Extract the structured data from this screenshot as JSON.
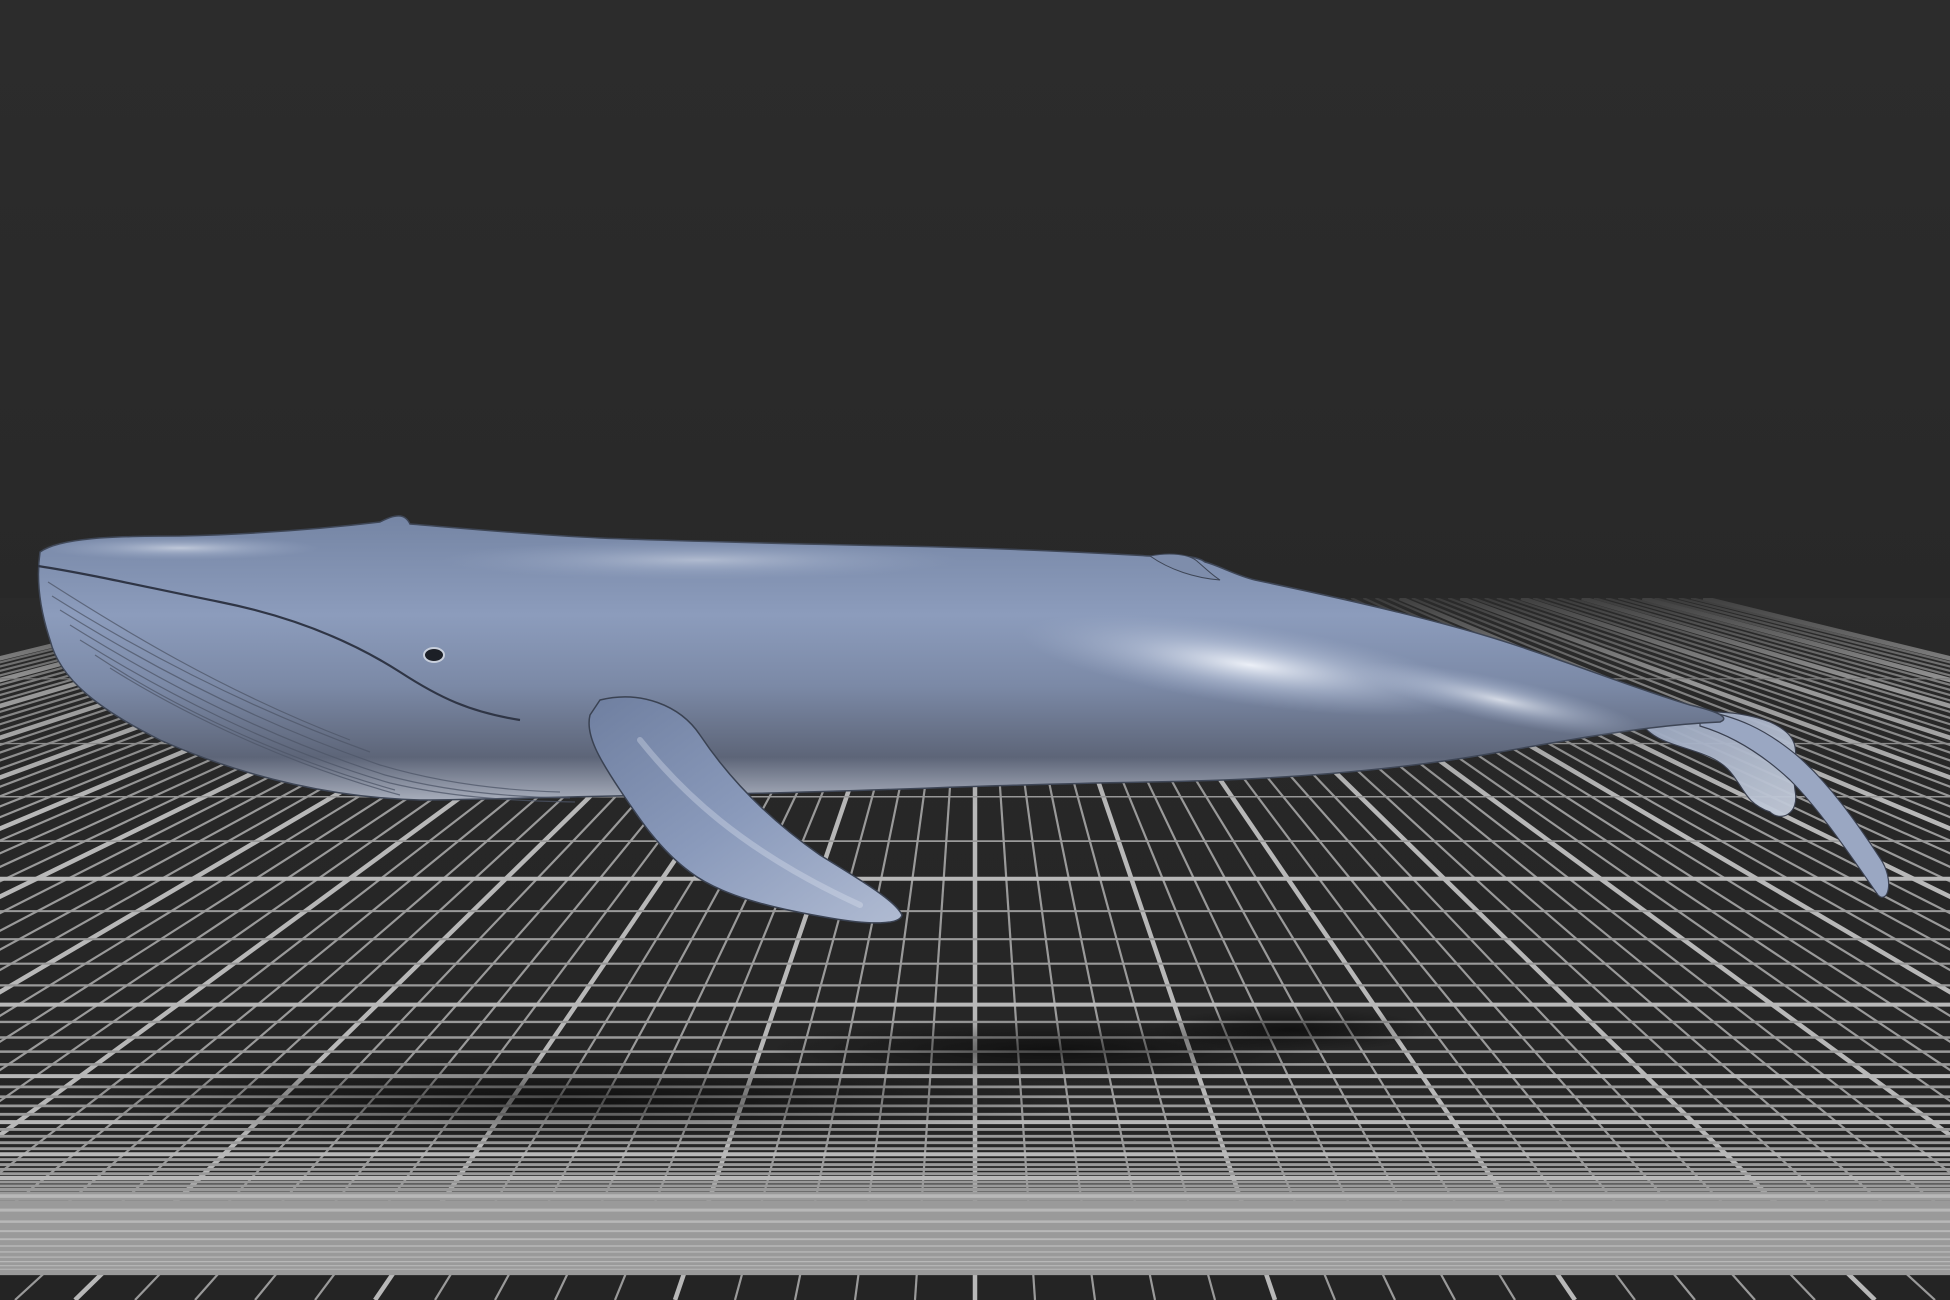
{
  "viewport": {
    "background_color": "#2a2a2a",
    "grid_color": "#9a9a9a",
    "grid_axis_color": "#b8b8b8",
    "model_color": "#8090b0",
    "model_highlight_color": "#dfe6f2",
    "model_shadow_color": "#3c4454"
  },
  "scene": {
    "model_name": "humpback-whale",
    "ground": "perspective-grid"
  }
}
